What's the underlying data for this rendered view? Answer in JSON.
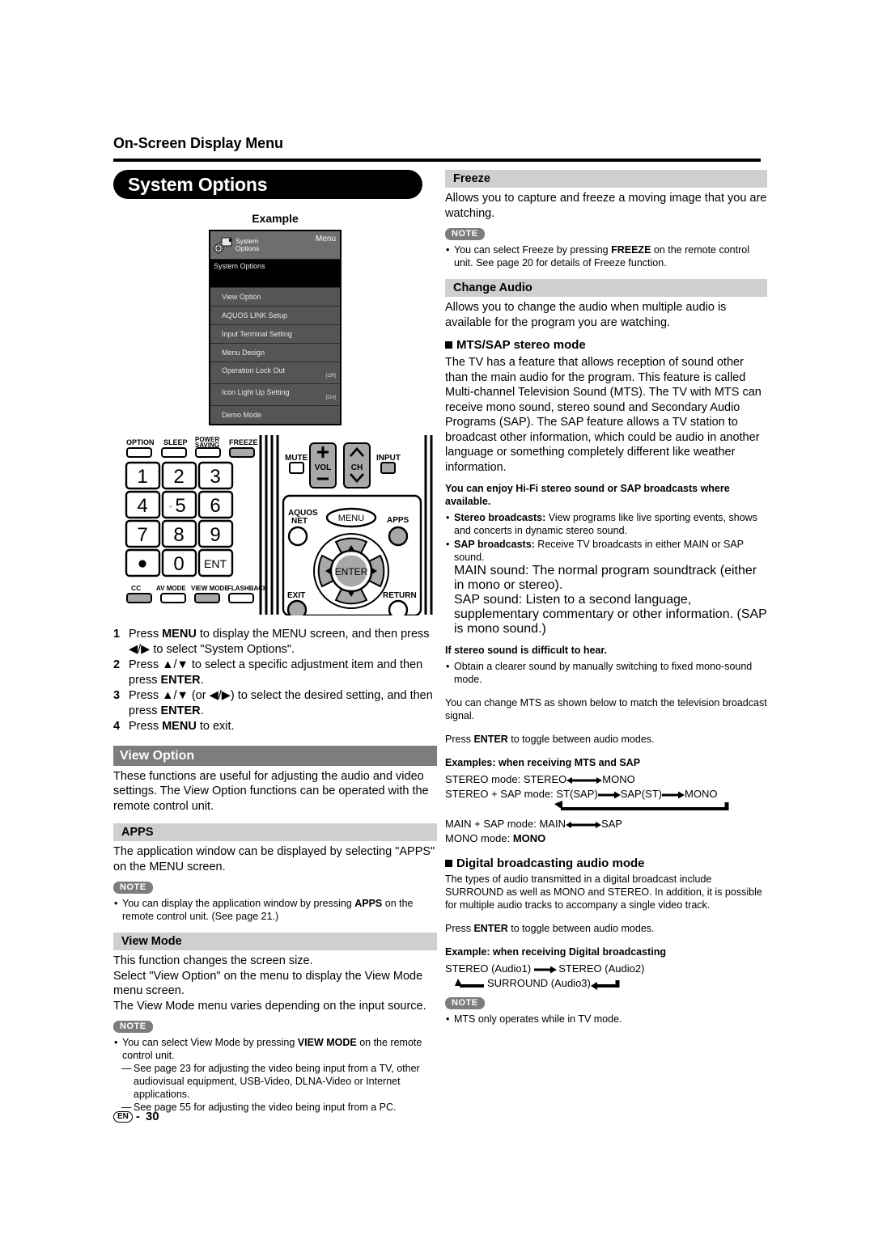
{
  "document": {
    "running_head": "On-Screen Display Menu",
    "page_footer_lang": "EN",
    "page_footer_sep": "-",
    "page_number": "30"
  },
  "colors": {
    "major_header_bg": "#7d7d7d",
    "minor_header_bg": "#cfcfcf",
    "pill_bg": "#000000",
    "osd_panel_bg": "#3f3f3f",
    "osd_item_bg": "#555555",
    "osd_top_bg": "#6e6e6e"
  },
  "left": {
    "pill_title": "System Options",
    "example_label": "Example",
    "osd": {
      "icon_name": "system-options-gear-icon",
      "title_line1": "System",
      "title_line2": "Options",
      "menu_word": "Menu",
      "current": "System Options",
      "items": [
        {
          "label": "View Option",
          "value": ""
        },
        {
          "label": "AQUOS LINK Setup",
          "value": ""
        },
        {
          "label": "Input Terminal Setting",
          "value": ""
        },
        {
          "label": "Menu Design",
          "value": ""
        },
        {
          "label": "Operation Lock Out",
          "value": "[Off]"
        },
        {
          "label": "Icon Light Up Setting",
          "value": "[On]"
        },
        {
          "label": "Demo Mode",
          "value": ""
        }
      ]
    },
    "remote": {
      "top_buttons": [
        "OPTION",
        "SLEEP",
        "POWER SAVING",
        "FREEZE"
      ],
      "power_saving_l1": "POWER",
      "power_saving_l2": "SAVING",
      "keypad": [
        "1",
        "2",
        "3",
        "4",
        "5",
        "6",
        "7",
        "8",
        "9",
        "•",
        "0",
        "ENT"
      ],
      "bottom_buttons": [
        "CC",
        "AV MODE",
        "VIEW MODE",
        "FLASHBACK"
      ],
      "mute": "MUTE",
      "vol": "VOL",
      "ch": "CH",
      "input": "INPUT",
      "aquos_net_l1": "AQUOS",
      "aquos_net_l2": "NET",
      "menu": "MENU",
      "apps": "APPS",
      "enter": "ENTER",
      "exit": "EXIT",
      "return": "RETURN"
    },
    "steps": [
      {
        "num": "1",
        "text_html": "Press <b>MENU</b> to display the MENU screen, and then press ◀/▶ to select \"System Options\"."
      },
      {
        "num": "2",
        "text_html": "Press ▲/▼ to select a specific adjustment item and then press <b>ENTER</b>."
      },
      {
        "num": "3",
        "text_html": "Press ▲/▼ (or ◀/▶) to select the desired setting, and then press <b>ENTER</b>."
      },
      {
        "num": "4",
        "text_html": "Press <b>MENU</b> to exit."
      }
    ],
    "view_option": {
      "header": "View Option",
      "body": "These functions are useful for adjusting the audio and video settings. The View Option functions can be operated with the remote control unit."
    },
    "apps": {
      "header": "APPS",
      "body": "The application window can be displayed by selecting \"APPS\" on the MENU screen.",
      "note_label": "NOTE",
      "note_items_html": [
        "You can display the application window by pressing <b>APPS</b> on the remote control unit. (See page 21.)"
      ]
    },
    "view_mode": {
      "header": "View Mode",
      "body_lines": [
        "This function changes the screen size.",
        "Select \"View Option\" on the menu to display the View Mode menu screen.",
        "The View Mode menu varies depending on the input source."
      ],
      "note_label": "NOTE",
      "note_items_html": [
        "You can select View Mode by pressing <b>VIEW MODE</b> on the remote control unit."
      ],
      "dash_items": [
        "See page 23 for adjusting the video being input from a TV, other audiovisual equipment, USB-Video, DLNA-Video or Internet applications.",
        "See page 55 for adjusting the video being input from a PC."
      ]
    }
  },
  "right": {
    "freeze": {
      "header": "Freeze",
      "body": "Allows you to capture and freeze a moving image that you are watching.",
      "note_label": "NOTE",
      "note_items_html": [
        "You can select Freeze by pressing <b>FREEZE</b> on the remote control unit. See page 20 for details of Freeze function."
      ]
    },
    "change_audio": {
      "header": "Change Audio",
      "body": "Allows you to change the audio when multiple audio is available for the program you are watching."
    },
    "mts_sap": {
      "sub_head": "MTS/SAP stereo mode",
      "body": "The TV has a feature that allows reception of sound other than the main audio for the program. This feature is called Multi-channel Television Sound (MTS). The TV with MTS can receive mono sound, stereo sound and Secondary Audio Programs (SAP). The SAP feature allows a TV station to broadcast other information, which could be audio in another language or something completely different like weather information.",
      "enjoy_head": "You can enjoy Hi-Fi stereo sound or SAP broadcasts where available.",
      "bullets_html": [
        "<b>Stereo broadcasts:</b> View programs like live sporting events, shows and concerts in dynamic stereo sound.",
        "<b>SAP broadcasts:</b> Receive TV broadcasts in either MAIN or SAP sound."
      ],
      "sap_detail_lines": [
        "MAIN sound: The normal program soundtrack (either in mono or stereo).",
        "SAP sound: Listen to a second language, supplementary commentary or other information. (SAP is mono sound.)"
      ],
      "difficult_head": "If stereo sound is difficult to hear.",
      "difficult_bullets": [
        "Obtain a clearer sound by manually switching to fixed mono-sound mode."
      ],
      "change_note": "You can change MTS as shown below to match the television broadcast signal.",
      "enter_toggle_html": "Press <b>ENTER</b> to toggle between audio modes.",
      "examples_head": "Examples: when receiving MTS and SAP",
      "example_rows": [
        {
          "label": "STEREO mode:",
          "from": "STEREO",
          "to": "MONO",
          "arrow": "double"
        },
        {
          "label": "STEREO + SAP mode:",
          "a": "ST(SAP)",
          "b": "SAP(ST)",
          "c": "MONO",
          "arrow": "chain"
        },
        {
          "label": "MAIN + SAP mode:",
          "from": "MAIN",
          "to": "SAP",
          "arrow": "double"
        },
        {
          "label": "MONO mode:",
          "from": "MONO",
          "to": "",
          "arrow": "none"
        }
      ]
    },
    "digital": {
      "sub_head": "Digital broadcasting audio mode",
      "body": "The types of audio transmitted in a digital broadcast include SURROUND as well as MONO and STEREO. In addition, it is possible for multiple audio tracks to accompany a single video track.",
      "enter_toggle_html": "Press <b>ENTER</b> to toggle between audio modes.",
      "example_head": "Example: when receiving Digital broadcasting",
      "line1_a": "STEREO (Audio1)",
      "line1_b": "STEREO (Audio2)",
      "line2": "SURROUND (Audio3)",
      "note_label": "NOTE",
      "note_items_html": [
        "MTS only operates while in TV mode."
      ]
    }
  }
}
